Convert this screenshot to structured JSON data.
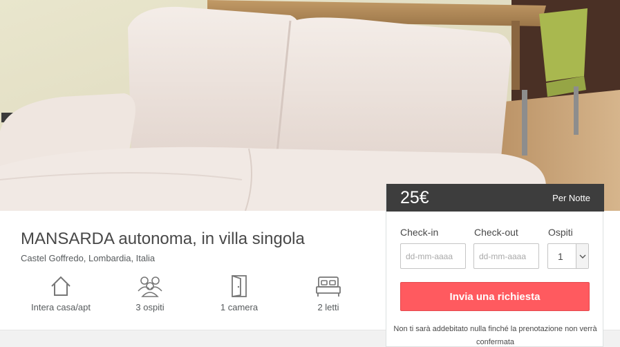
{
  "listing": {
    "title": "MANSARDA autonoma, in villa singola",
    "location": "Castel Goffredo, Lombardia, Italia",
    "amenities": [
      {
        "icon": "house-icon",
        "label": "Intera casa/apt"
      },
      {
        "icon": "guests-icon",
        "label": "3 ospiti"
      },
      {
        "icon": "door-icon",
        "label": "1 camera"
      },
      {
        "icon": "bed-icon",
        "label": "2 letti"
      }
    ]
  },
  "booking": {
    "price": "25€",
    "period": "Per Notte",
    "checkin_label": "Check-in",
    "checkout_label": "Check-out",
    "guests_label": "Ospiti",
    "checkin_placeholder": "dd-mm-aaaa",
    "checkout_placeholder": "dd-mm-aaaa",
    "guests_value": "1",
    "submit_label": "Invia una richiesta",
    "note": "Non ti sarà addebitato nulla finché la prenotazione non verrà confermata"
  },
  "colors": {
    "accent": "#ff5a5f",
    "price_bar": "#3d3d3d"
  }
}
